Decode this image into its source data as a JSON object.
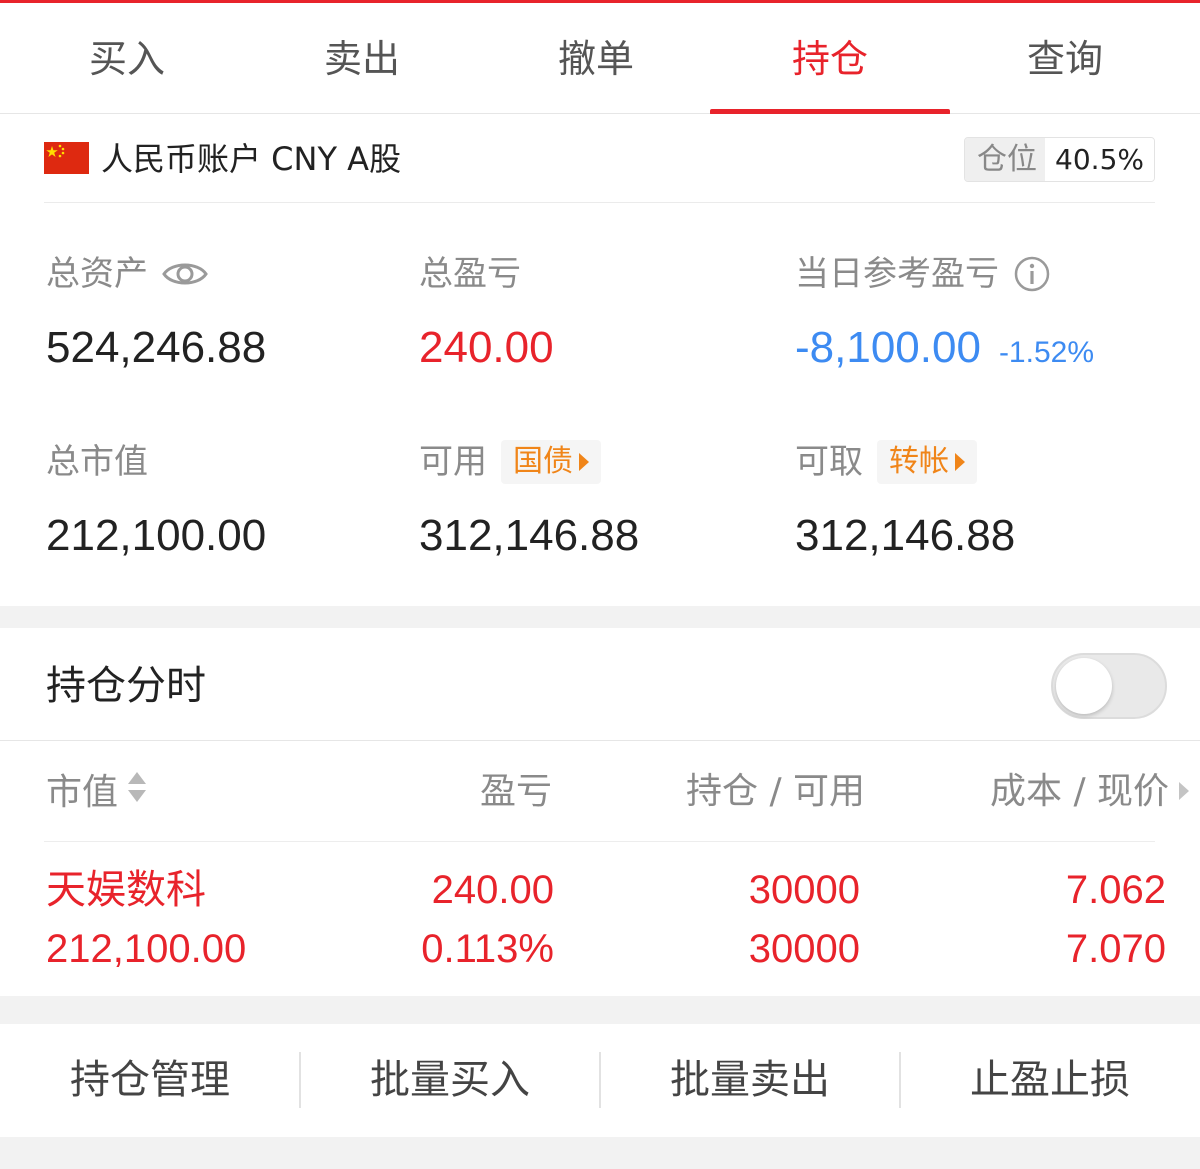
{
  "tabs": [
    {
      "label": "买入"
    },
    {
      "label": "卖出"
    },
    {
      "label": "撤单"
    },
    {
      "label": "持仓",
      "active": true
    },
    {
      "label": "查询"
    }
  ],
  "account": {
    "name": "人民币账户 CNY A股",
    "flag_icon": "china-flag-icon",
    "position_label": "仓位",
    "position_value": "40.5%"
  },
  "metrics": {
    "total_assets": {
      "label": "总资产",
      "value": "524,246.88",
      "icon": "eye-icon"
    },
    "total_pnl": {
      "label": "总盈亏",
      "value": "240.00"
    },
    "daily_pnl": {
      "label": "当日参考盈亏",
      "value": "-8,100.00",
      "pct": "-1.52%",
      "icon": "info-icon"
    },
    "market_value": {
      "label": "总市值",
      "value": "212,100.00"
    },
    "available": {
      "label": "可用",
      "value": "312,146.88",
      "tag": "国债"
    },
    "withdrawable": {
      "label": "可取",
      "value": "312,146.88",
      "tag": "转帐"
    }
  },
  "holdings_section": {
    "title": "持仓分时",
    "toggle_on": false,
    "columns": [
      "市值",
      "盈亏",
      "持仓 / 可用",
      "成本 / 现价"
    ],
    "rows": [
      {
        "name": "天娱数科",
        "market_value": "212,100.00",
        "pnl": "240.00",
        "pnl_pct": "0.113%",
        "position": "30000",
        "available": "30000",
        "cost": "7.062",
        "price": "7.070"
      }
    ]
  },
  "actions": [
    {
      "label": "持仓管理"
    },
    {
      "label": "批量买入"
    },
    {
      "label": "批量卖出"
    },
    {
      "label": "止盈止损"
    }
  ],
  "colors": {
    "accent": "#e8232b",
    "down": "#3d8bf2",
    "tag": "#f08519"
  }
}
